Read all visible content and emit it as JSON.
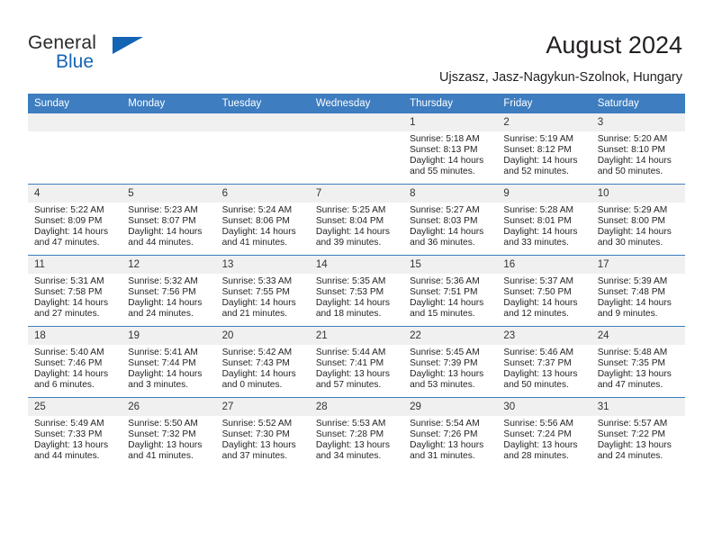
{
  "brand": {
    "name_part1": "General",
    "name_part2": "Blue"
  },
  "header": {
    "title": "August 2024",
    "subtitle": "Ujszasz, Jasz-Nagykun-Szolnok, Hungary"
  },
  "colors": {
    "header_blue": "#3d7dc0",
    "brand_blue": "#1464b4",
    "daynum_band": "#f0f0f0",
    "text": "#231f20"
  },
  "calendar": {
    "weekday_headers": [
      "Sunday",
      "Monday",
      "Tuesday",
      "Wednesday",
      "Thursday",
      "Friday",
      "Saturday"
    ],
    "weeks": [
      [
        {
          "day": "",
          "empty": true,
          "lines": []
        },
        {
          "day": "",
          "empty": true,
          "lines": []
        },
        {
          "day": "",
          "empty": true,
          "lines": []
        },
        {
          "day": "",
          "empty": true,
          "lines": []
        },
        {
          "day": "1",
          "empty": false,
          "lines": [
            "Sunrise: 5:18 AM",
            "Sunset: 8:13 PM",
            "Daylight: 14 hours",
            "and 55 minutes."
          ]
        },
        {
          "day": "2",
          "empty": false,
          "lines": [
            "Sunrise: 5:19 AM",
            "Sunset: 8:12 PM",
            "Daylight: 14 hours",
            "and 52 minutes."
          ]
        },
        {
          "day": "3",
          "empty": false,
          "lines": [
            "Sunrise: 5:20 AM",
            "Sunset: 8:10 PM",
            "Daylight: 14 hours",
            "and 50 minutes."
          ]
        }
      ],
      [
        {
          "day": "4",
          "empty": false,
          "lines": [
            "Sunrise: 5:22 AM",
            "Sunset: 8:09 PM",
            "Daylight: 14 hours",
            "and 47 minutes."
          ]
        },
        {
          "day": "5",
          "empty": false,
          "lines": [
            "Sunrise: 5:23 AM",
            "Sunset: 8:07 PM",
            "Daylight: 14 hours",
            "and 44 minutes."
          ]
        },
        {
          "day": "6",
          "empty": false,
          "lines": [
            "Sunrise: 5:24 AM",
            "Sunset: 8:06 PM",
            "Daylight: 14 hours",
            "and 41 minutes."
          ]
        },
        {
          "day": "7",
          "empty": false,
          "lines": [
            "Sunrise: 5:25 AM",
            "Sunset: 8:04 PM",
            "Daylight: 14 hours",
            "and 39 minutes."
          ]
        },
        {
          "day": "8",
          "empty": false,
          "lines": [
            "Sunrise: 5:27 AM",
            "Sunset: 8:03 PM",
            "Daylight: 14 hours",
            "and 36 minutes."
          ]
        },
        {
          "day": "9",
          "empty": false,
          "lines": [
            "Sunrise: 5:28 AM",
            "Sunset: 8:01 PM",
            "Daylight: 14 hours",
            "and 33 minutes."
          ]
        },
        {
          "day": "10",
          "empty": false,
          "lines": [
            "Sunrise: 5:29 AM",
            "Sunset: 8:00 PM",
            "Daylight: 14 hours",
            "and 30 minutes."
          ]
        }
      ],
      [
        {
          "day": "11",
          "empty": false,
          "lines": [
            "Sunrise: 5:31 AM",
            "Sunset: 7:58 PM",
            "Daylight: 14 hours",
            "and 27 minutes."
          ]
        },
        {
          "day": "12",
          "empty": false,
          "lines": [
            "Sunrise: 5:32 AM",
            "Sunset: 7:56 PM",
            "Daylight: 14 hours",
            "and 24 minutes."
          ]
        },
        {
          "day": "13",
          "empty": false,
          "lines": [
            "Sunrise: 5:33 AM",
            "Sunset: 7:55 PM",
            "Daylight: 14 hours",
            "and 21 minutes."
          ]
        },
        {
          "day": "14",
          "empty": false,
          "lines": [
            "Sunrise: 5:35 AM",
            "Sunset: 7:53 PM",
            "Daylight: 14 hours",
            "and 18 minutes."
          ]
        },
        {
          "day": "15",
          "empty": false,
          "lines": [
            "Sunrise: 5:36 AM",
            "Sunset: 7:51 PM",
            "Daylight: 14 hours",
            "and 15 minutes."
          ]
        },
        {
          "day": "16",
          "empty": false,
          "lines": [
            "Sunrise: 5:37 AM",
            "Sunset: 7:50 PM",
            "Daylight: 14 hours",
            "and 12 minutes."
          ]
        },
        {
          "day": "17",
          "empty": false,
          "lines": [
            "Sunrise: 5:39 AM",
            "Sunset: 7:48 PM",
            "Daylight: 14 hours",
            "and 9 minutes."
          ]
        }
      ],
      [
        {
          "day": "18",
          "empty": false,
          "lines": [
            "Sunrise: 5:40 AM",
            "Sunset: 7:46 PM",
            "Daylight: 14 hours",
            "and 6 minutes."
          ]
        },
        {
          "day": "19",
          "empty": false,
          "lines": [
            "Sunrise: 5:41 AM",
            "Sunset: 7:44 PM",
            "Daylight: 14 hours",
            "and 3 minutes."
          ]
        },
        {
          "day": "20",
          "empty": false,
          "lines": [
            "Sunrise: 5:42 AM",
            "Sunset: 7:43 PM",
            "Daylight: 14 hours",
            "and 0 minutes."
          ]
        },
        {
          "day": "21",
          "empty": false,
          "lines": [
            "Sunrise: 5:44 AM",
            "Sunset: 7:41 PM",
            "Daylight: 13 hours",
            "and 57 minutes."
          ]
        },
        {
          "day": "22",
          "empty": false,
          "lines": [
            "Sunrise: 5:45 AM",
            "Sunset: 7:39 PM",
            "Daylight: 13 hours",
            "and 53 minutes."
          ]
        },
        {
          "day": "23",
          "empty": false,
          "lines": [
            "Sunrise: 5:46 AM",
            "Sunset: 7:37 PM",
            "Daylight: 13 hours",
            "and 50 minutes."
          ]
        },
        {
          "day": "24",
          "empty": false,
          "lines": [
            "Sunrise: 5:48 AM",
            "Sunset: 7:35 PM",
            "Daylight: 13 hours",
            "and 47 minutes."
          ]
        }
      ],
      [
        {
          "day": "25",
          "empty": false,
          "lines": [
            "Sunrise: 5:49 AM",
            "Sunset: 7:33 PM",
            "Daylight: 13 hours",
            "and 44 minutes."
          ]
        },
        {
          "day": "26",
          "empty": false,
          "lines": [
            "Sunrise: 5:50 AM",
            "Sunset: 7:32 PM",
            "Daylight: 13 hours",
            "and 41 minutes."
          ]
        },
        {
          "day": "27",
          "empty": false,
          "lines": [
            "Sunrise: 5:52 AM",
            "Sunset: 7:30 PM",
            "Daylight: 13 hours",
            "and 37 minutes."
          ]
        },
        {
          "day": "28",
          "empty": false,
          "lines": [
            "Sunrise: 5:53 AM",
            "Sunset: 7:28 PM",
            "Daylight: 13 hours",
            "and 34 minutes."
          ]
        },
        {
          "day": "29",
          "empty": false,
          "lines": [
            "Sunrise: 5:54 AM",
            "Sunset: 7:26 PM",
            "Daylight: 13 hours",
            "and 31 minutes."
          ]
        },
        {
          "day": "30",
          "empty": false,
          "lines": [
            "Sunrise: 5:56 AM",
            "Sunset: 7:24 PM",
            "Daylight: 13 hours",
            "and 28 minutes."
          ]
        },
        {
          "day": "31",
          "empty": false,
          "lines": [
            "Sunrise: 5:57 AM",
            "Sunset: 7:22 PM",
            "Daylight: 13 hours",
            "and 24 minutes."
          ]
        }
      ]
    ]
  }
}
